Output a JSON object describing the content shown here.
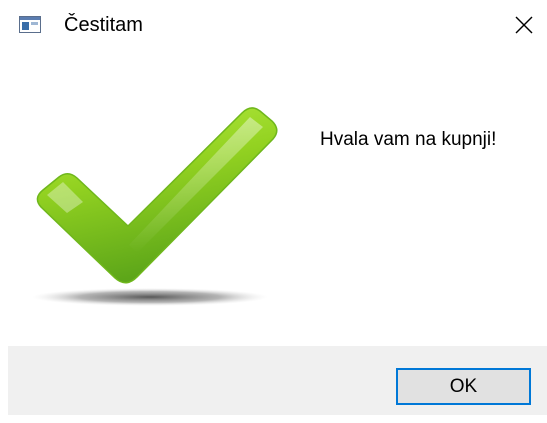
{
  "window": {
    "title": "Čestitam",
    "icon": "window-app-icon",
    "close_icon": "close-icon"
  },
  "content": {
    "image": "checkmark-icon",
    "image_colors": {
      "light": "#a8e63a",
      "mid": "#8ccd1e",
      "dark": "#5fa61a"
    },
    "message": "Hvala vam na kupnji!"
  },
  "footer": {
    "ok_label": "OK",
    "accent": "#0078d7"
  }
}
